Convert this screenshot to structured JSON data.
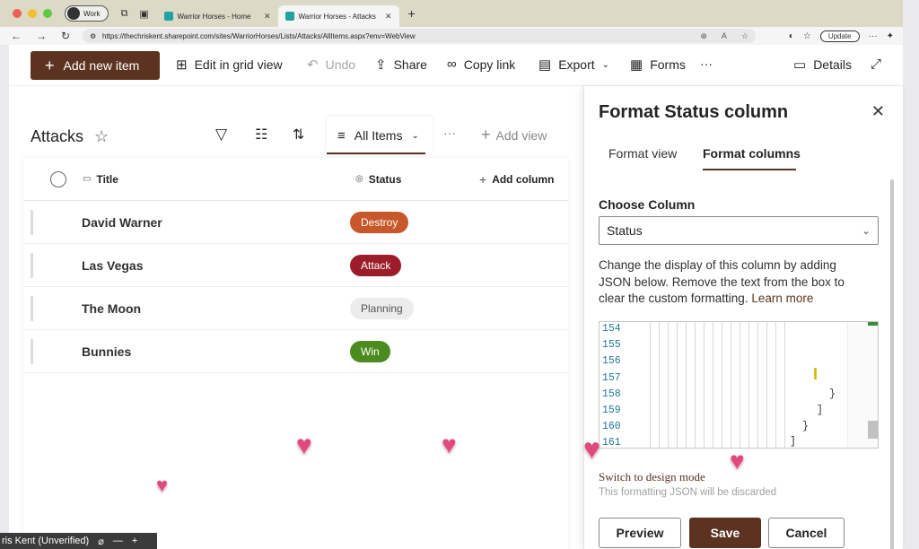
{
  "browser": {
    "profile_label": "Work",
    "tabs": [
      {
        "label": "Warrior Horses - Home"
      },
      {
        "label": "Warrior Horses - Attacks"
      }
    ],
    "url": "https://thechriskent.sharepoint.com/sites/WarriorHorses/Lists/Attacks/AllItems.aspx?env=WebView",
    "update_label": "Update"
  },
  "commandbar": {
    "add_new_item": "Add new item",
    "edit_grid": "Edit in grid view",
    "undo": "Undo",
    "share": "Share",
    "copy_link": "Copy link",
    "export": "Export",
    "forms": "Forms",
    "more": "···",
    "details": "Details"
  },
  "list": {
    "title": "Attacks",
    "view_name": "All Items",
    "view_more": "···",
    "add_view": "Add view",
    "columns": {
      "title": "Title",
      "status": "Status",
      "add_column": "Add column"
    },
    "rows": [
      {
        "title": "David Warner",
        "status": "Destroy",
        "color": "#c8572a",
        "text": "#ffffff"
      },
      {
        "title": "Las Vegas",
        "status": "Attack",
        "color": "#9b1d2a",
        "text": "#ffffff"
      },
      {
        "title": "The Moon",
        "status": "Planning",
        "color": "#ececec",
        "text": "#555555"
      },
      {
        "title": "Bunnies",
        "status": "Win",
        "color": "#4b8b1f",
        "text": "#ffffff"
      }
    ]
  },
  "panel": {
    "title": "Format Status column",
    "tabs": [
      "Format view",
      "Format columns"
    ],
    "active_tab": "Format columns",
    "choose_column_label": "Choose Column",
    "choose_column_value": "Status",
    "description": "Change the display of this column by adding JSON below. Remove the text from the box to clear the custom formatting.",
    "learn_more": "Learn more",
    "editor_lines": [
      "154",
      "155",
      "156",
      "157",
      "158",
      "159",
      "160",
      "161"
    ],
    "editor_code": [
      "}",
      "]",
      "}",
      "]"
    ],
    "design_mode": "Switch to design mode",
    "design_note": "This formatting JSON will be discarded",
    "buttons": {
      "preview": "Preview",
      "save": "Save",
      "cancel": "Cancel"
    }
  },
  "meeting": {
    "user": "ris Kent (Unverified)"
  },
  "colors": {
    "accent": "#5c3320",
    "tabbar": "#dcd9c6"
  }
}
